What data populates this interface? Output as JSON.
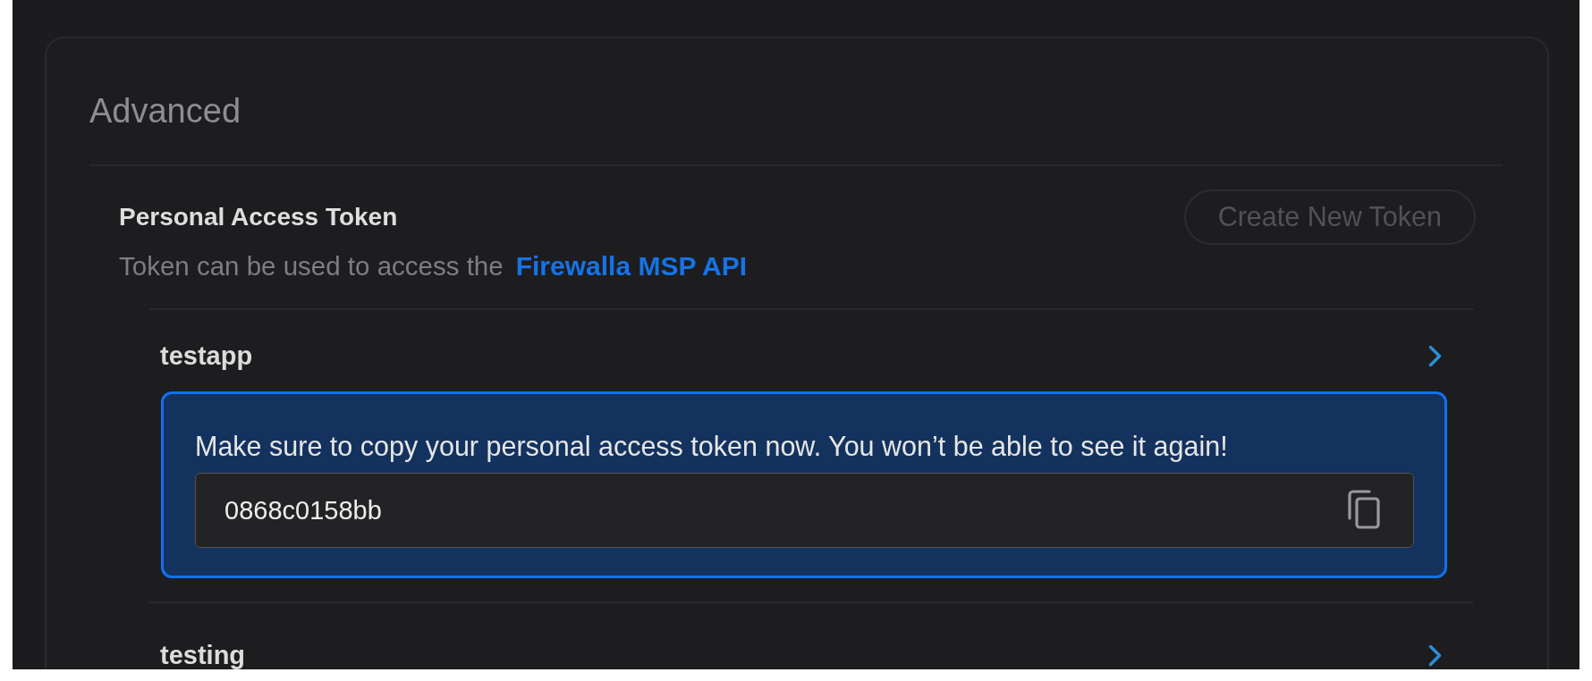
{
  "section": {
    "title": "Advanced"
  },
  "personal_access_token": {
    "title": "Personal Access Token",
    "description": "Token can be used to access the",
    "link": "Firewalla MSP API",
    "create_button": {
      "label": "Create New Token",
      "disabled": true
    }
  },
  "tokens": [
    {
      "name": "testapp",
      "new_token": {
        "message": "Make sure to copy your personal access token now. You won’t be able to see it again!",
        "value": "0868c0158bb"
      }
    },
    {
      "name": "testing"
    }
  ]
}
